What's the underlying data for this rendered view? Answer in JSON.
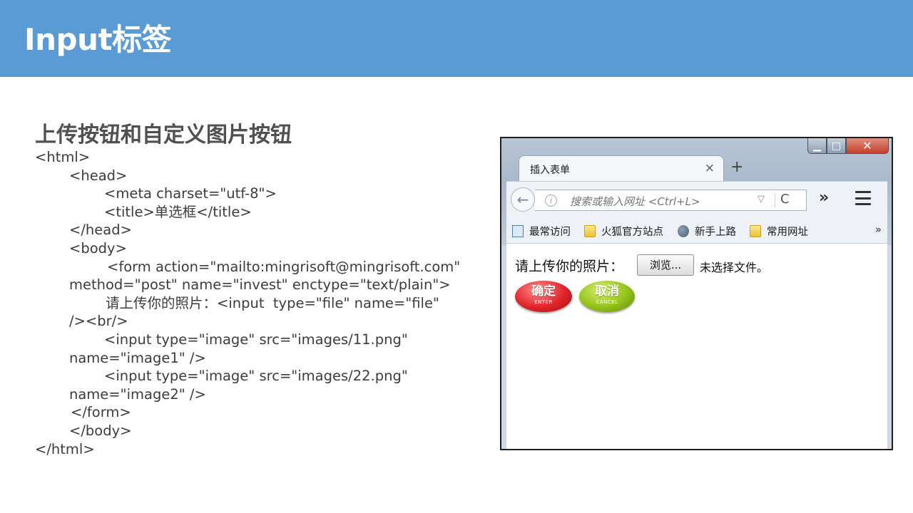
{
  "header": {
    "title": "Input标签",
    "color": "#5b9bd5"
  },
  "section": {
    "title": "上传按钮和自定义图片按钮"
  },
  "code": {
    "lines": [
      "<html>",
      "<head>",
      "<meta charset=\"utf-8\">",
      "<title>单选框</title>",
      "</head>",
      "<body>",
      "<form action=\"mailto:mingrisoft@mingrisoft.com\"",
      "method=\"post\" name=\"invest\" enctype=\"text/plain\">",
      "请上传你的照片：<input  type=\"file\" name=\"file\"",
      "/><br/>",
      "<input type=\"image\" src=\"images/11.png\"",
      "name=\"image1\" />",
      "<input type=\"image\" src=\"images/22.png\"",
      "name=\"image2\" />",
      "</form>",
      "</body>",
      "</html>"
    ]
  },
  "browser": {
    "window_controls": {
      "minimize": "▁",
      "maximize": "□",
      "close": "✕"
    },
    "tab": {
      "title": "插入表单",
      "close": "×"
    },
    "new_tab": "+",
    "back": "←",
    "url": {
      "info": "i",
      "placeholder": "搜索或输入网址 <Ctrl+L>",
      "dropdown": "▽",
      "reload": "C"
    },
    "overflow": "»",
    "bookmarks": [
      {
        "label": "最常访问",
        "icon": "page-icon"
      },
      {
        "label": "火狐官方站点",
        "icon": "folder-icon"
      },
      {
        "label": "新手上路",
        "icon": "globe-icon"
      },
      {
        "label": "常用网址",
        "icon": "folder-icon"
      }
    ],
    "bookmarks_more": "»",
    "form": {
      "label": "请上传你的照片：",
      "browse": "浏览...",
      "no_file": "未选择文件。",
      "ok_button": {
        "main": "确定",
        "sub": "ENTER"
      },
      "cancel_button": {
        "main": "取消",
        "sub": "CANCEL"
      }
    }
  }
}
